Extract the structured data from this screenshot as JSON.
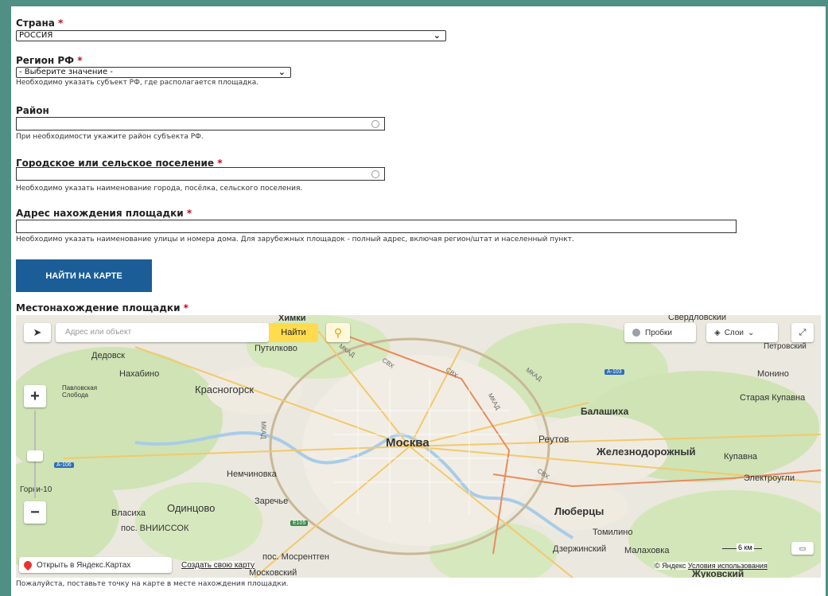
{
  "form": {
    "country": {
      "label": "Страна",
      "value": "РОССИЯ"
    },
    "region": {
      "label": "Регион РФ",
      "value": "- Выберите значение -",
      "hint": "Необходимо указать субъект РФ, где располагается площадка."
    },
    "district": {
      "label": "Район",
      "hint": "При необходимости укажите район субъекта РФ."
    },
    "settlement": {
      "label": "Городское или сельское поселение",
      "hint": "Необходимо указать наименование города, посёлка, сельского поселения."
    },
    "address": {
      "label": "Адрес нахождения площадки",
      "hint": "Необходимо указать наименование улицы и номера дома. Для зарубежных площадок - полный адрес, включая регион/штат и населенный пункт."
    },
    "required_mark": "*",
    "find_button": "НАЙТИ НА КАРТЕ",
    "location_label": "Местонахождение площадки",
    "location_hint": "Пожалуйста, поставьте точку на карте в месте нахождения площадки."
  },
  "map": {
    "search_placeholder": "Адрес или объект",
    "search_button": "Найти",
    "traffic": "Пробки",
    "layers": "Слои",
    "open_in_yandex": "Открыть в Яндекс.Картах",
    "create_map": "Создать свою карту",
    "copyright": "© Яндекс",
    "terms": "Условия использования",
    "scale": "6 км",
    "cities": {
      "putilkovo": "Путилково",
      "dedovsk": "Дедовск",
      "nakhabino": "Нахабино",
      "pavlovskaya": "Павловская Слобода",
      "krasnogorsk": "Красногорск",
      "moskva": "Москва",
      "reutov": "Реутов",
      "balashikha": "Балашиха",
      "zheleznodorozhny": "Железнодорожный",
      "kupavna": "Купавна",
      "staraya_kupavna": "Старая Купавна",
      "monino": "Монино",
      "elektrougli": "Электроугли",
      "nemchinovka": "Немчиновка",
      "zarechye": "Заречье",
      "odintsovo": "Одинцово",
      "vlasikha": "Власиха",
      "vniissok": "пос. ВНИИССОК",
      "gorki10": "Горки-10",
      "lyubertsy": "Люберцы",
      "tomilino": "Томилино",
      "dzerzhinsky": "Дзержинский",
      "malakhovka": "Малаховка",
      "mosrentgen": "пос. Мосрентген",
      "moskovsky": "Московский",
      "zhukovsky": "Жуковский",
      "sverdlovsky": "Свердловский",
      "petrovsky": "Петровский",
      "khimki": "Химки"
    },
    "roads": {
      "mkad": "МКАД",
      "cvk": "СВХ",
      "a103": "А-103",
      "a106": "А-106",
      "e105": "E105"
    }
  }
}
